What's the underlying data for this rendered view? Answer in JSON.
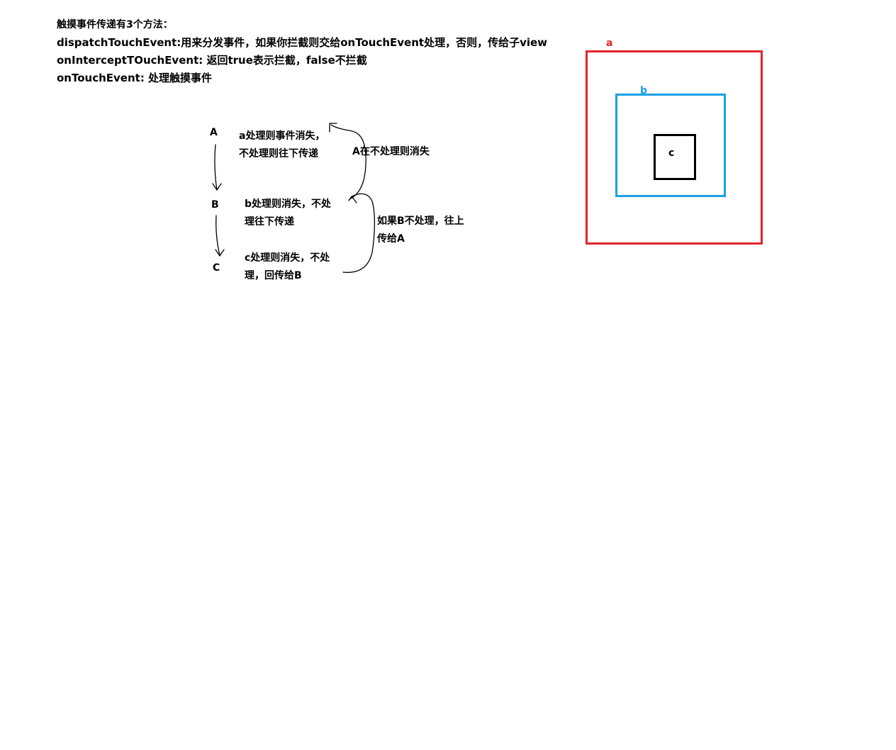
{
  "notes": {
    "title": "触摸事件传递有3个方法：",
    "line1": "dispatchTouchEvent:用来分发事件，如果你拦截则交给onTouchEvent处理，否则，传给子view",
    "line2": "onInterceptTOuchEvent: 返回true表示拦截，false不拦截",
    "line3": "onTouchEvent: 处理触摸事件"
  },
  "flow": {
    "node_a": "A",
    "node_b": "B",
    "node_c": "C",
    "a_text_1": "a处理则事件消失，",
    "a_text_2": "不处理则往下传递",
    "b_text_1": "b处理则消失，不处",
    "b_text_2": "理往下传递",
    "c_text_1": "c处理则消失，不处",
    "c_text_2": "理，回传给B",
    "up_a_label": "A在不处理则消失",
    "up_b_label_1": "如果B不处理，往上",
    "up_b_label_2": "传给A"
  },
  "nested_views": {
    "a_label": "a",
    "b_label": "b",
    "c_label": "c",
    "a_color": "#e0242b",
    "b_color": "#1ba1e2",
    "c_color": "#000000"
  }
}
